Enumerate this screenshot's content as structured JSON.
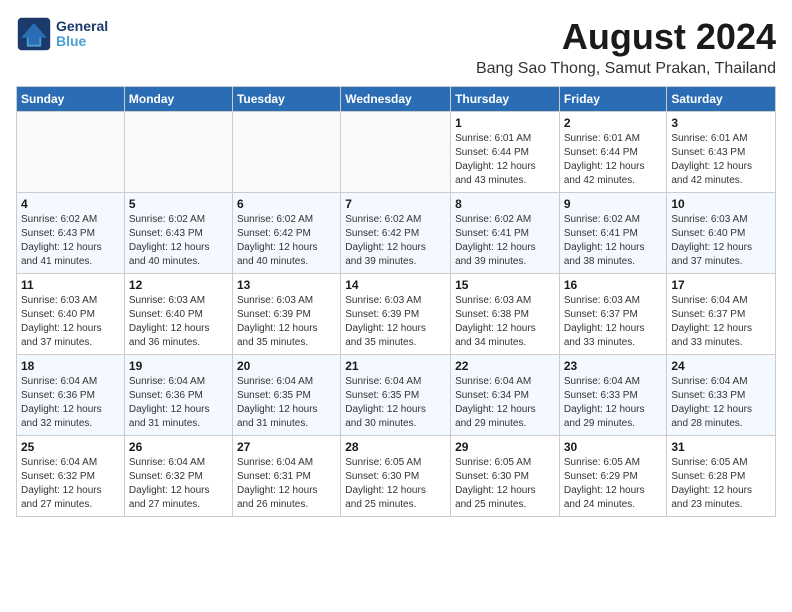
{
  "header": {
    "logo_line1": "General",
    "logo_line2": "Blue",
    "title": "August 2024",
    "subtitle": "Bang Sao Thong, Samut Prakan, Thailand"
  },
  "weekdays": [
    "Sunday",
    "Monday",
    "Tuesday",
    "Wednesday",
    "Thursday",
    "Friday",
    "Saturday"
  ],
  "weeks": [
    [
      {
        "num": "",
        "info": ""
      },
      {
        "num": "",
        "info": ""
      },
      {
        "num": "",
        "info": ""
      },
      {
        "num": "",
        "info": ""
      },
      {
        "num": "1",
        "info": "Sunrise: 6:01 AM\nSunset: 6:44 PM\nDaylight: 12 hours\nand 43 minutes."
      },
      {
        "num": "2",
        "info": "Sunrise: 6:01 AM\nSunset: 6:44 PM\nDaylight: 12 hours\nand 42 minutes."
      },
      {
        "num": "3",
        "info": "Sunrise: 6:01 AM\nSunset: 6:43 PM\nDaylight: 12 hours\nand 42 minutes."
      }
    ],
    [
      {
        "num": "4",
        "info": "Sunrise: 6:02 AM\nSunset: 6:43 PM\nDaylight: 12 hours\nand 41 minutes."
      },
      {
        "num": "5",
        "info": "Sunrise: 6:02 AM\nSunset: 6:43 PM\nDaylight: 12 hours\nand 40 minutes."
      },
      {
        "num": "6",
        "info": "Sunrise: 6:02 AM\nSunset: 6:42 PM\nDaylight: 12 hours\nand 40 minutes."
      },
      {
        "num": "7",
        "info": "Sunrise: 6:02 AM\nSunset: 6:42 PM\nDaylight: 12 hours\nand 39 minutes."
      },
      {
        "num": "8",
        "info": "Sunrise: 6:02 AM\nSunset: 6:41 PM\nDaylight: 12 hours\nand 39 minutes."
      },
      {
        "num": "9",
        "info": "Sunrise: 6:02 AM\nSunset: 6:41 PM\nDaylight: 12 hours\nand 38 minutes."
      },
      {
        "num": "10",
        "info": "Sunrise: 6:03 AM\nSunset: 6:40 PM\nDaylight: 12 hours\nand 37 minutes."
      }
    ],
    [
      {
        "num": "11",
        "info": "Sunrise: 6:03 AM\nSunset: 6:40 PM\nDaylight: 12 hours\nand 37 minutes."
      },
      {
        "num": "12",
        "info": "Sunrise: 6:03 AM\nSunset: 6:40 PM\nDaylight: 12 hours\nand 36 minutes."
      },
      {
        "num": "13",
        "info": "Sunrise: 6:03 AM\nSunset: 6:39 PM\nDaylight: 12 hours\nand 35 minutes."
      },
      {
        "num": "14",
        "info": "Sunrise: 6:03 AM\nSunset: 6:39 PM\nDaylight: 12 hours\nand 35 minutes."
      },
      {
        "num": "15",
        "info": "Sunrise: 6:03 AM\nSunset: 6:38 PM\nDaylight: 12 hours\nand 34 minutes."
      },
      {
        "num": "16",
        "info": "Sunrise: 6:03 AM\nSunset: 6:37 PM\nDaylight: 12 hours\nand 33 minutes."
      },
      {
        "num": "17",
        "info": "Sunrise: 6:04 AM\nSunset: 6:37 PM\nDaylight: 12 hours\nand 33 minutes."
      }
    ],
    [
      {
        "num": "18",
        "info": "Sunrise: 6:04 AM\nSunset: 6:36 PM\nDaylight: 12 hours\nand 32 minutes."
      },
      {
        "num": "19",
        "info": "Sunrise: 6:04 AM\nSunset: 6:36 PM\nDaylight: 12 hours\nand 31 minutes."
      },
      {
        "num": "20",
        "info": "Sunrise: 6:04 AM\nSunset: 6:35 PM\nDaylight: 12 hours\nand 31 minutes."
      },
      {
        "num": "21",
        "info": "Sunrise: 6:04 AM\nSunset: 6:35 PM\nDaylight: 12 hours\nand 30 minutes."
      },
      {
        "num": "22",
        "info": "Sunrise: 6:04 AM\nSunset: 6:34 PM\nDaylight: 12 hours\nand 29 minutes."
      },
      {
        "num": "23",
        "info": "Sunrise: 6:04 AM\nSunset: 6:33 PM\nDaylight: 12 hours\nand 29 minutes."
      },
      {
        "num": "24",
        "info": "Sunrise: 6:04 AM\nSunset: 6:33 PM\nDaylight: 12 hours\nand 28 minutes."
      }
    ],
    [
      {
        "num": "25",
        "info": "Sunrise: 6:04 AM\nSunset: 6:32 PM\nDaylight: 12 hours\nand 27 minutes."
      },
      {
        "num": "26",
        "info": "Sunrise: 6:04 AM\nSunset: 6:32 PM\nDaylight: 12 hours\nand 27 minutes."
      },
      {
        "num": "27",
        "info": "Sunrise: 6:04 AM\nSunset: 6:31 PM\nDaylight: 12 hours\nand 26 minutes."
      },
      {
        "num": "28",
        "info": "Sunrise: 6:05 AM\nSunset: 6:30 PM\nDaylight: 12 hours\nand 25 minutes."
      },
      {
        "num": "29",
        "info": "Sunrise: 6:05 AM\nSunset: 6:30 PM\nDaylight: 12 hours\nand 25 minutes."
      },
      {
        "num": "30",
        "info": "Sunrise: 6:05 AM\nSunset: 6:29 PM\nDaylight: 12 hours\nand 24 minutes."
      },
      {
        "num": "31",
        "info": "Sunrise: 6:05 AM\nSunset: 6:28 PM\nDaylight: 12 hours\nand 23 minutes."
      }
    ]
  ]
}
